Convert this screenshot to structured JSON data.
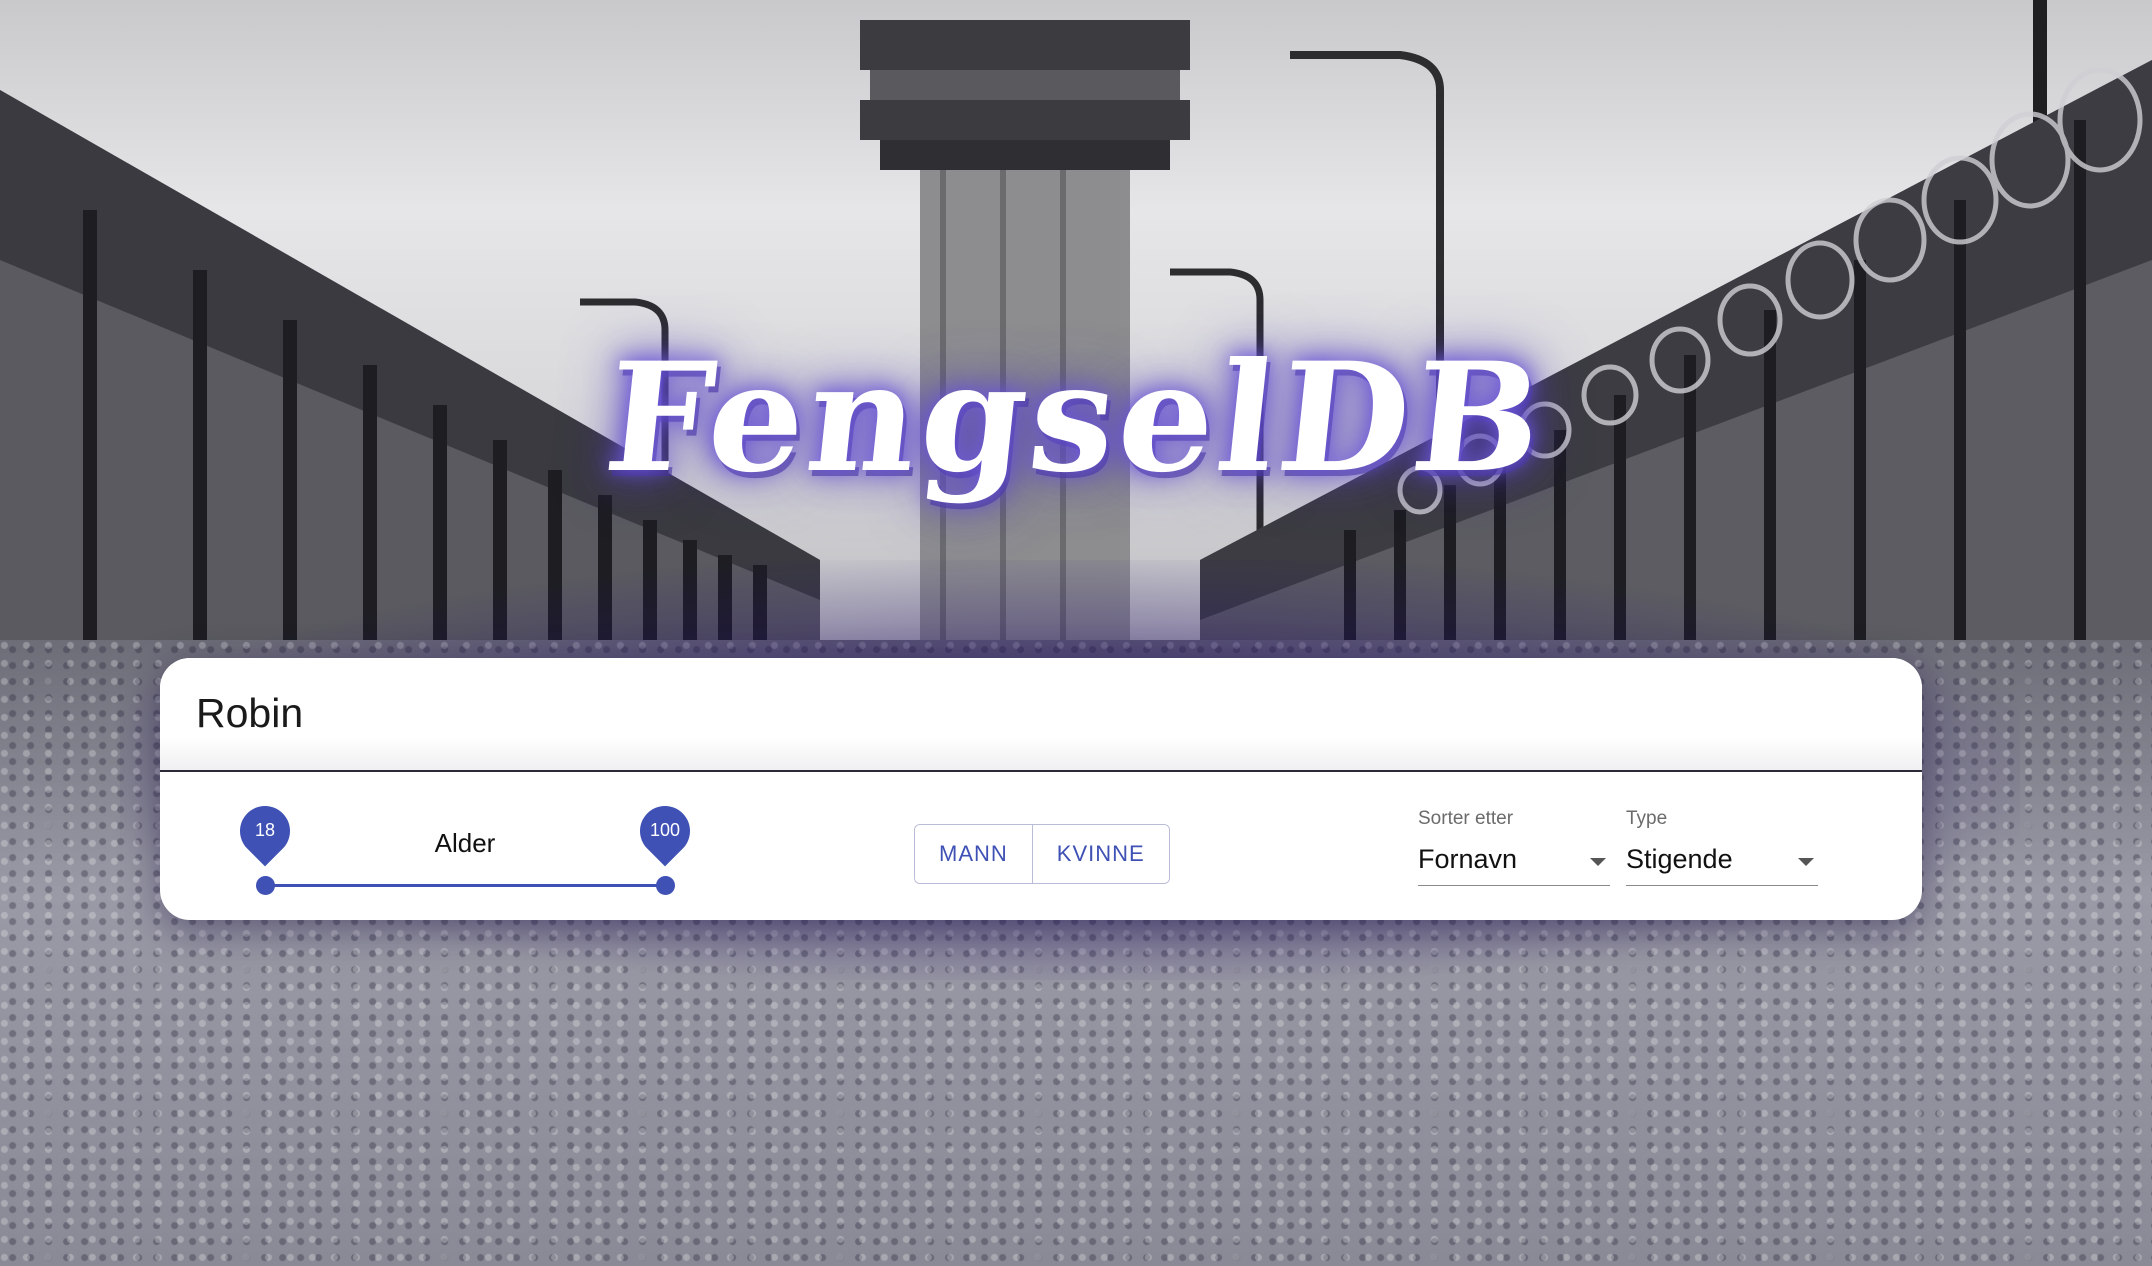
{
  "app": {
    "title": "FengselDB"
  },
  "search": {
    "value": "Robin"
  },
  "age_filter": {
    "label": "Alder",
    "min_value": "18",
    "max_value": "100",
    "range_min": 18,
    "range_max": 100
  },
  "gender_toggle": {
    "options": [
      "MANN",
      "KVINNE"
    ]
  },
  "sort": {
    "label": "Sorter etter",
    "value": "Fornavn"
  },
  "order": {
    "label": "Type",
    "value": "Stigende"
  },
  "colors": {
    "accent": "#3f51b5",
    "title_glow": "#6e5adc",
    "card_background": "#ffffff"
  },
  "icons": {
    "sort_dropdown": "arrow-drop-down-icon",
    "order_dropdown": "arrow-drop-down-icon"
  }
}
